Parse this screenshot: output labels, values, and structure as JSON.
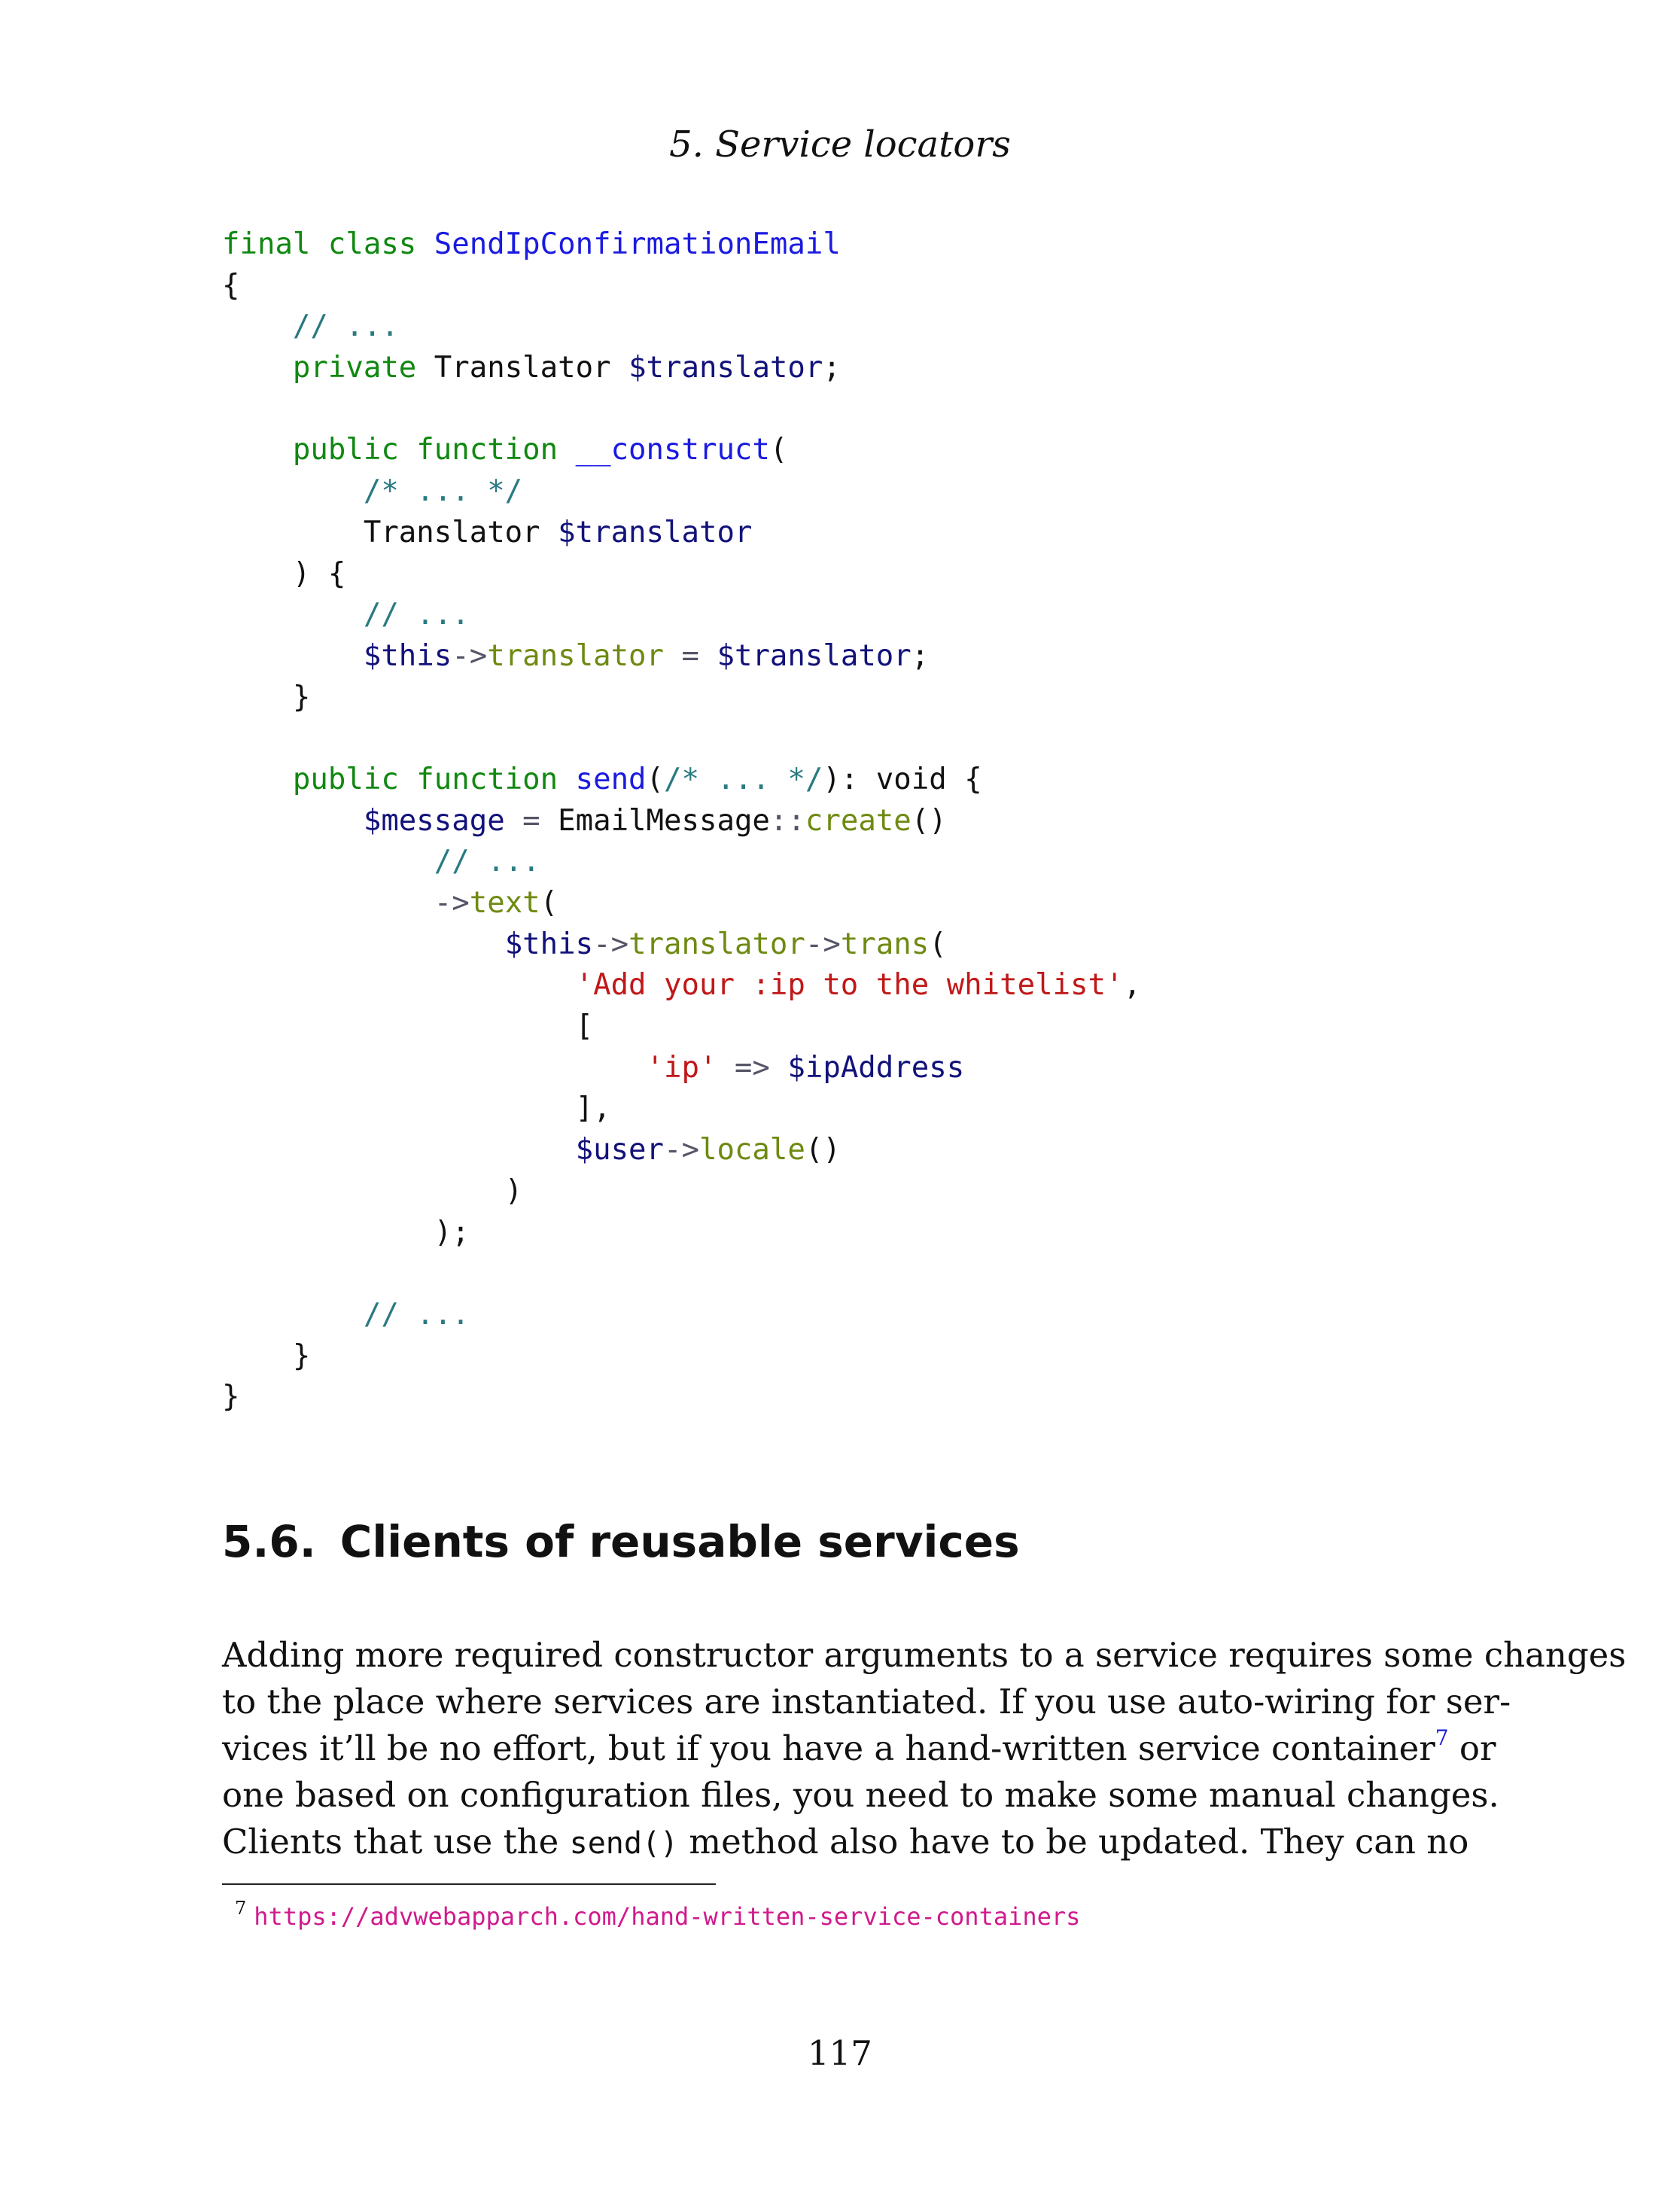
{
  "running_head": "5.  Service locators",
  "code": {
    "line1_kw": "final class",
    "line1_class": "SendIpConfirmationEmail",
    "line2": "{",
    "line3_comment": "// ...",
    "line4_kw": "private",
    "line4_type": "Translator",
    "line4_var": "$translator",
    "line4_end": ";",
    "line6_kw": "public function",
    "line6_fn": "__construct",
    "line6_paren": "(",
    "line7_comment": "/* ... */",
    "line8_type": "Translator",
    "line8_var": "$translator",
    "line9": ") {",
    "line10_comment": "// ...",
    "line11_this": "$this",
    "line11_arrow": "->",
    "line11_prop": "translator",
    "line11_eq": " = ",
    "line11_var": "$translator",
    "line11_end": ";",
    "line12": "}",
    "line14_kw": "public function",
    "line14_fn": "send",
    "line14_open": "(",
    "line14_comment": "/* ... */",
    "line14_close": "):",
    "line14_rest": " void {",
    "line15_var": "$message",
    "line15_eq": " = ",
    "line15_cls": "EmailMessage",
    "line15_op": "::",
    "line15_method": "create",
    "line15_end": "()",
    "line16_comment": "// ...",
    "line17_arrow": "->",
    "line17_method": "text",
    "line17_paren": "(",
    "line18_this": "$this",
    "line18_arrow1": "->",
    "line18_prop": "translator",
    "line18_arrow2": "->",
    "line18_method": "trans",
    "line18_paren": "(",
    "line19_str": "'Add your :ip to the whitelist'",
    "line19_end": ",",
    "line20": "[",
    "line21_str": "'ip'",
    "line21_op": " => ",
    "line21_var": "$ipAddress",
    "line22": "],",
    "line23_var": "$user",
    "line23_arrow": "->",
    "line23_method": "locale",
    "line23_end": "()",
    "line24": ")",
    "line25": ");",
    "line27_comment": "// ...",
    "line28": "}",
    "line29": "}"
  },
  "section": {
    "number": "5.6.",
    "title": "Clients of reusable services"
  },
  "body": {
    "line1": "Adding more required constructor arguments to a service requires some changes",
    "line2": "to the place where services are instantiated.  If you use auto-wiring for ser-",
    "line3_before": "vices it’ll be no effort, but if you have a hand-written service container",
    "line3_ref": "7",
    "line3_after": " or",
    "line4": "one based on configuration files, you need to make some manual changes.",
    "line5_before": "Clients that use the ",
    "line5_code": "send()",
    "line5_after": " method also have to be updated.  They can no"
  },
  "footnote": {
    "mark": "7",
    "url": "https://advwebapparch.com/hand-written-service-containers"
  },
  "page_number": "117"
}
